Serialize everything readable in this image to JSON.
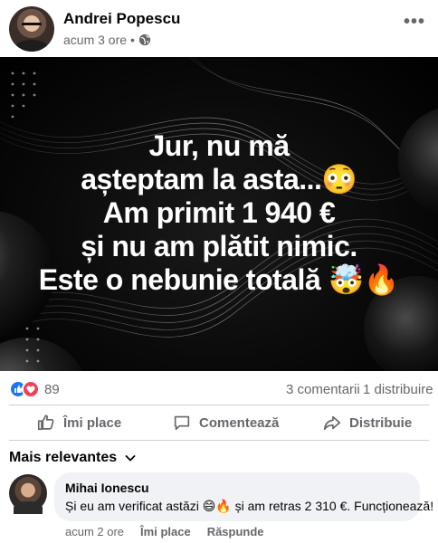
{
  "post": {
    "author": "Andrei Popescu",
    "time": "acum 3 ore",
    "separator": "•",
    "image_text": [
      "Jur, nu mă",
      "așteptam la asta...😳",
      "Am primit 1 940 €",
      "și nu am plătit nimic.",
      "Este o nebunie totală 🤯🔥"
    ]
  },
  "stats": {
    "reaction_count": "89",
    "comments": "3 comentarii",
    "shares": "1 distribuire"
  },
  "actions": {
    "like": "Îmi place",
    "comment": "Comentează",
    "share": "Distribuie"
  },
  "comments": {
    "sort_label": "Mais relevantes",
    "items": [
      {
        "author": "Mihai Ionescu",
        "text": "Și eu am verificat astăzi 😄🔥 și am retras 2 310 €. Funcționează! 💸",
        "time": "acum 2 ore",
        "like": "Îmi place",
        "reply": "Răspunde"
      }
    ]
  },
  "colors": {
    "secondary_text": "#65676b",
    "like_blue": "#1877f2",
    "love_red": "#f33e58",
    "comment_bg": "#f0f2f5"
  }
}
